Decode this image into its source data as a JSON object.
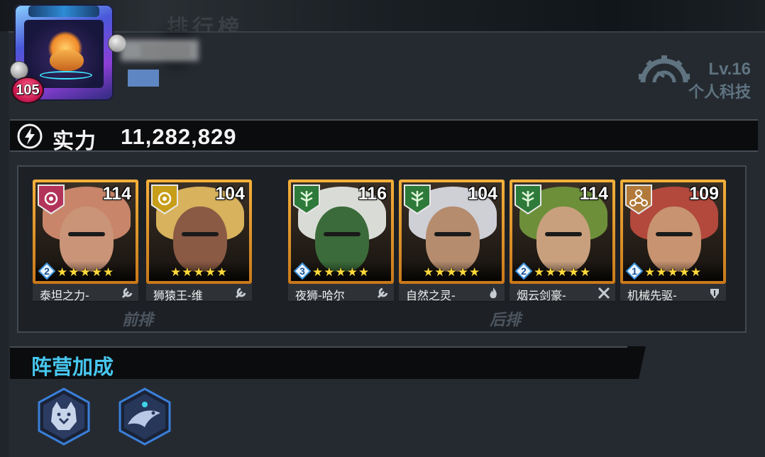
{
  "background_title": "排行榜",
  "player": {
    "level": "105"
  },
  "tech": {
    "level": "Lv.16",
    "label": "个人科技"
  },
  "power": {
    "label": "实力",
    "value": "11,282,829"
  },
  "lineup": {
    "front_label": "前排",
    "back_label": "后排",
    "heroes": [
      {
        "name": "泰坦之力-",
        "level": "114",
        "grade": "2",
        "stars": "★★★★★",
        "faction_icon": "target-faction-icon",
        "faction_color": "#b3345b",
        "class_icon": "wrench-icon",
        "frame": "#e09a2b",
        "hair": "#c8856a",
        "skin": "#c99478"
      },
      {
        "name": "狮猿王-维",
        "level": "104",
        "grade": "",
        "stars": "★★★★★",
        "faction_icon": "target-faction-icon",
        "faction_color": "#c79d19",
        "class_icon": "wrench-icon",
        "frame": "#e09a2b",
        "hair": "#d8b25c",
        "skin": "#8a5a44"
      },
      {
        "name": "夜狮-哈尔",
        "level": "116",
        "grade": "3",
        "stars": "★★★★★",
        "faction_icon": "tree-faction-icon",
        "faction_color": "#2e7a3a",
        "class_icon": "wrench-icon",
        "frame": "#e09a2b",
        "hair": "#d9dcd6",
        "skin": "#3b6b3a"
      },
      {
        "name": "自然之灵-",
        "level": "104",
        "grade": "",
        "stars": "★★★★★",
        "faction_icon": "tree-faction-icon",
        "faction_color": "#2e7a3a",
        "class_icon": "fire-icon",
        "frame": "#e09a2b",
        "hair": "#cfcfd6",
        "skin": "#b58c6e"
      },
      {
        "name": "烟云剑豪-",
        "level": "114",
        "grade": "2",
        "stars": "★★★★★",
        "faction_icon": "tree-faction-icon",
        "faction_color": "#2e7a3a",
        "class_icon": "crossed-swords-icon",
        "frame": "#e09a2b",
        "hair": "#6d8f3a",
        "skin": "#c9a07e"
      },
      {
        "name": "机械先驱-",
        "level": "109",
        "grade": "1",
        "stars": "★★★★★",
        "faction_icon": "mech-faction-icon",
        "faction_color": "#b27a3a",
        "class_icon": "armor-icon",
        "frame": "#e09a2b",
        "hair": "#b3483d",
        "skin": "#c79370"
      }
    ]
  },
  "faction_bonus": {
    "title": "阵营加成",
    "icons": [
      "wolf-bonus-icon",
      "bird-bonus-icon"
    ]
  }
}
